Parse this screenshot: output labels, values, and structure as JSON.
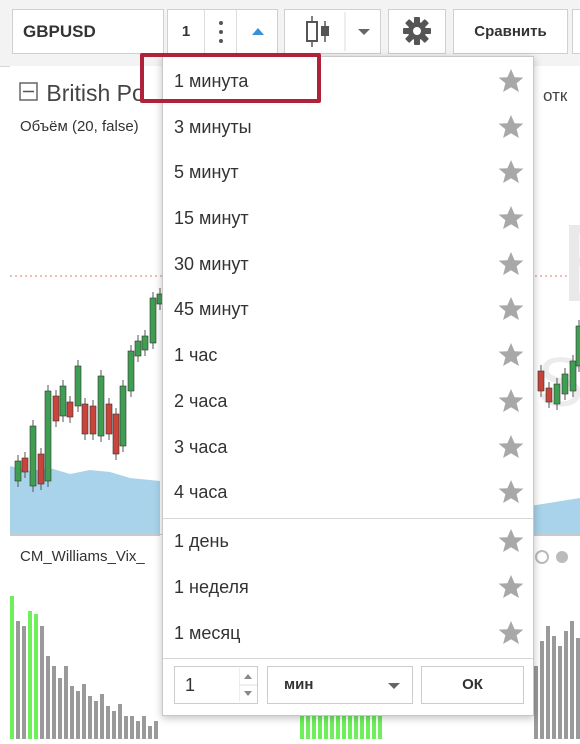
{
  "toolbar": {
    "symbol": "GBPUSD",
    "interval_value": "1",
    "compare_label": "Сравнить"
  },
  "chart": {
    "title": "British Po",
    "right_label": "отк",
    "volume_label": "Объём (20, false)",
    "indicator_label": "CM_Williams_Vix_"
  },
  "interval_menu": {
    "items": [
      {
        "label": "1 минута",
        "selected": true
      },
      {
        "label": "3 минуты"
      },
      {
        "label": "5 минут"
      },
      {
        "label": "15 минут"
      },
      {
        "label": "30 минут"
      },
      {
        "label": "45 минут"
      },
      {
        "label": "1 час"
      },
      {
        "label": "2 часа"
      },
      {
        "label": "3 часа"
      },
      {
        "label": "4 часа"
      },
      {
        "label": "1 день"
      },
      {
        "label": "1 неделя"
      },
      {
        "label": "1 месяц"
      }
    ],
    "custom": {
      "value": "1",
      "unit": "мин",
      "ok_label": "ОК"
    }
  },
  "colors": {
    "highlight_border": "#b0213a",
    "star": "#a8a8a8",
    "candle_up": "#3f9e52",
    "candle_down": "#c9453b",
    "volume": "#a9d3ea",
    "vix_gray": "#9a9a9a",
    "vix_green": "#6df05a"
  }
}
